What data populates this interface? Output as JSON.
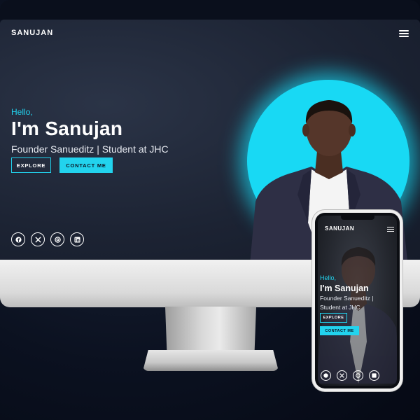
{
  "site": {
    "brand": "SANUJAN"
  },
  "hero": {
    "hello": "Hello,",
    "headline": "I'm Sanujan",
    "tagline": "Founder Sanueditz | Student at JHC",
    "explore_label": "EXPLORE",
    "contact_label": "CONTACT ME"
  },
  "phone": {
    "brand": "SANUJAN",
    "hello": "Hello,",
    "headline": "I'm Sanujan",
    "tagline": "Founder Sanueditz | Student at JHC",
    "explore_label": "EXPLORE",
    "contact_label": "CONTACT ME"
  },
  "social_icons": [
    "facebook-icon",
    "x-icon",
    "threads-icon",
    "linkedin-icon"
  ],
  "colors": {
    "accent": "#22d3ee",
    "background": "#1c2333",
    "text": "#ffffff"
  }
}
